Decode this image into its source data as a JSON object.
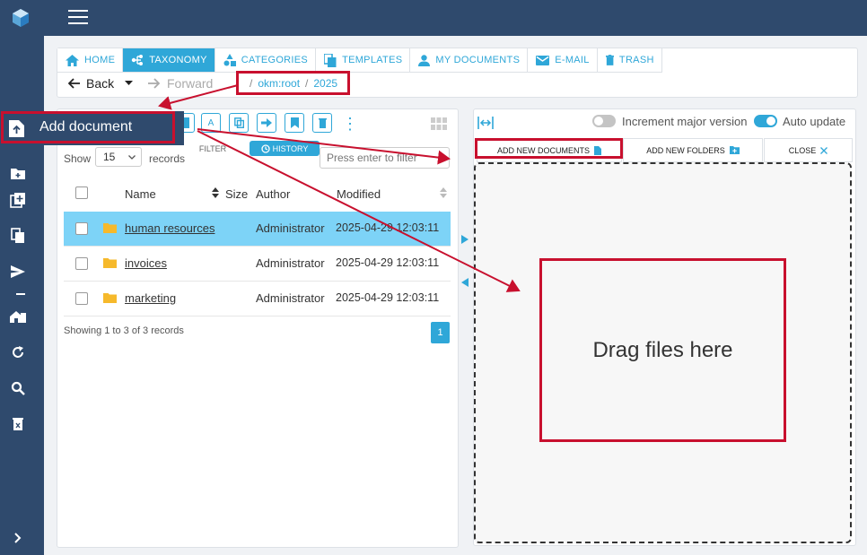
{
  "tabs": [
    {
      "label": "HOME",
      "icon": "home-icon"
    },
    {
      "label": "TAXONOMY",
      "icon": "taxonomy-icon"
    },
    {
      "label": "CATEGORIES",
      "icon": "categories-icon"
    },
    {
      "label": "TEMPLATES",
      "icon": "templates-icon"
    },
    {
      "label": "MY DOCUMENTS",
      "icon": "user-icon"
    },
    {
      "label": "E-MAIL",
      "icon": "mail-icon"
    },
    {
      "label": "TRASH",
      "icon": "trash-icon"
    }
  ],
  "active_tab": "TAXONOMY",
  "nav": {
    "back": "Back",
    "forward": "Forward"
  },
  "breadcrumb": [
    "okm:root",
    "2025"
  ],
  "toolbar": {
    "filter_tab": "FILTER",
    "history_tab": "HISTORY"
  },
  "table": {
    "show_label": "Show",
    "page_size": "15",
    "records_label": "records",
    "filter_placeholder": "Press enter to filter",
    "headers": {
      "name": "Name",
      "size": "Size",
      "author": "Author",
      "modified": "Modified"
    },
    "rows": [
      {
        "name": "human resources",
        "author": "Administrator",
        "modified": "2025-04-29 12:03:11",
        "selected": true
      },
      {
        "name": "invoices",
        "author": "Administrator",
        "modified": "2025-04-29 12:03:11",
        "selected": false
      },
      {
        "name": "marketing",
        "author": "Administrator",
        "modified": "2025-04-29 12:03:11",
        "selected": false
      }
    ],
    "showing": "Showing 1 to 3 of 3 records",
    "page": "1"
  },
  "upload": {
    "increment_label": "Increment major version",
    "increment_on": false,
    "auto_update_label": "Auto update",
    "auto_update_on": true,
    "tabs": {
      "docs": "ADD NEW DOCUMENTS",
      "folders": "ADD NEW FOLDERS",
      "close": "CLOSE"
    },
    "drop_text": "Drag files here"
  },
  "popup": {
    "add_document": "Add document"
  },
  "colors": {
    "accent": "#2fa7d8",
    "sidebar": "#2f4a6d",
    "annotation": "#c8102e",
    "selected_row": "#7dd3f7"
  }
}
